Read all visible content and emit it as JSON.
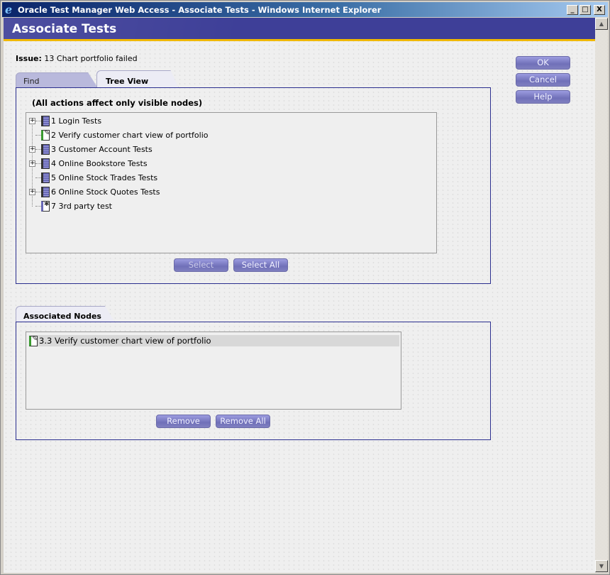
{
  "window": {
    "title": "Oracle Test Manager Web Access - Associate Tests - Windows Internet Explorer",
    "controls": {
      "minimize": "_",
      "maximize": "□",
      "close": "X"
    }
  },
  "header": {
    "title": "Associate Tests"
  },
  "issue": {
    "label": "Issue:",
    "value": "13 Chart portfolio failed"
  },
  "actions": {
    "ok": "OK",
    "cancel": "Cancel",
    "help": "Help"
  },
  "tabs": [
    {
      "label": "Find",
      "active": false
    },
    {
      "label": "Tree View",
      "active": true
    }
  ],
  "tree_panel": {
    "note": "(All actions affect only visible nodes)",
    "nodes": [
      {
        "label": "1 Login Tests",
        "icon": "book-icon",
        "expandable": true
      },
      {
        "label": "2 Verify customer chart view of portfolio",
        "icon": "test-doc-icon",
        "expandable": false
      },
      {
        "label": "3 Customer Account Tests",
        "icon": "book-icon",
        "expandable": true
      },
      {
        "label": "4 Online Bookstore Tests",
        "icon": "book-icon",
        "expandable": true
      },
      {
        "label": "5 Online Stock Trades Tests",
        "icon": "book-icon",
        "expandable": false
      },
      {
        "label": "6 Online Stock Quotes Tests",
        "icon": "book-icon",
        "expandable": true
      },
      {
        "label": "7 3rd party test",
        "icon": "third-party-test-icon",
        "expandable": false
      }
    ],
    "buttons": {
      "select": "Select",
      "select_all": "Select All"
    }
  },
  "associated": {
    "tab_label": "Associated Nodes",
    "items": [
      {
        "label": "3.3 Verify customer chart view of portfolio",
        "icon": "test-doc-icon"
      }
    ],
    "buttons": {
      "remove": "Remove",
      "remove_all": "Remove All"
    }
  },
  "scrollbar": {
    "up": "▲",
    "down": "▼"
  }
}
